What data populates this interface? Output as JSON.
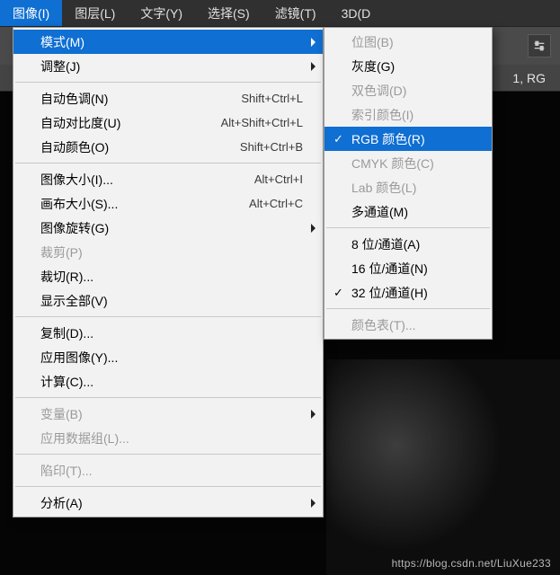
{
  "menubar": [
    {
      "label": "图像(I)",
      "open": true
    },
    {
      "label": "图层(L)"
    },
    {
      "label": "文字(Y)"
    },
    {
      "label": "选择(S)"
    },
    {
      "label": "滤镜(T)"
    },
    {
      "label": "3D(D"
    }
  ],
  "docinfo": "1, RG",
  "watermark": "https://blog.csdn.net/LiuXue233",
  "menu": {
    "groups": [
      [
        {
          "label": "模式(M)",
          "submenu": true,
          "highlight": true
        },
        {
          "label": "调整(J)",
          "submenu": true
        }
      ],
      [
        {
          "label": "自动色调(N)",
          "accel": "Shift+Ctrl+L"
        },
        {
          "label": "自动对比度(U)",
          "accel": "Alt+Shift+Ctrl+L"
        },
        {
          "label": "自动颜色(O)",
          "accel": "Shift+Ctrl+B"
        }
      ],
      [
        {
          "label": "图像大小(I)...",
          "accel": "Alt+Ctrl+I"
        },
        {
          "label": "画布大小(S)...",
          "accel": "Alt+Ctrl+C"
        },
        {
          "label": "图像旋转(G)",
          "submenu": true
        },
        {
          "label": "裁剪(P)",
          "disabled": true
        },
        {
          "label": "裁切(R)..."
        },
        {
          "label": "显示全部(V)"
        }
      ],
      [
        {
          "label": "复制(D)..."
        },
        {
          "label": "应用图像(Y)..."
        },
        {
          "label": "计算(C)..."
        }
      ],
      [
        {
          "label": "变量(B)",
          "submenu": true,
          "disabled": true
        },
        {
          "label": "应用数据组(L)...",
          "disabled": true
        }
      ],
      [
        {
          "label": "陷印(T)...",
          "disabled": true
        }
      ],
      [
        {
          "label": "分析(A)",
          "submenu": true
        }
      ]
    ]
  },
  "submenu": {
    "groups": [
      [
        {
          "label": "位图(B)",
          "disabled": true
        },
        {
          "label": "灰度(G)"
        },
        {
          "label": "双色调(D)",
          "disabled": true
        },
        {
          "label": "索引颜色(I)",
          "disabled": true
        },
        {
          "label": "RGB 颜色(R)",
          "checked": true,
          "highlight": true
        },
        {
          "label": "CMYK 颜色(C)",
          "disabled": true
        },
        {
          "label": "Lab 颜色(L)",
          "disabled": true
        },
        {
          "label": "多通道(M)"
        }
      ],
      [
        {
          "label": "8 位/通道(A)"
        },
        {
          "label": "16 位/通道(N)"
        },
        {
          "label": "32 位/通道(H)",
          "checked": true
        }
      ],
      [
        {
          "label": "颜色表(T)...",
          "disabled": true
        }
      ]
    ]
  }
}
